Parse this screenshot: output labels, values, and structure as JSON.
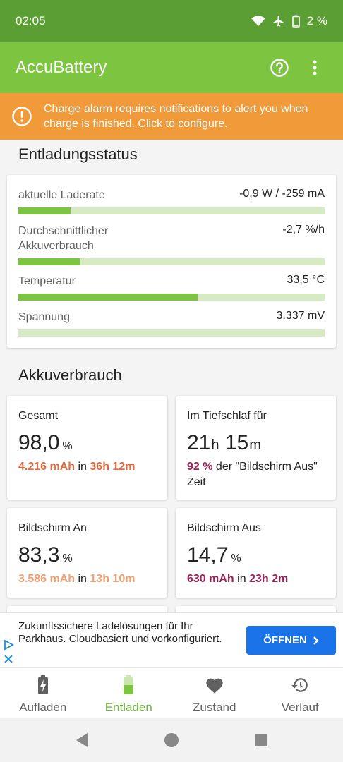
{
  "status_bar": {
    "time": "02:05",
    "battery_percent": "2 %"
  },
  "app_bar": {
    "title": "AccuBattery"
  },
  "alert": {
    "text": "Charge alarm requires notifications to alert you when charge is finished. Click to configure."
  },
  "discharge_status": {
    "title": "Entladungsstatus",
    "rows": [
      {
        "label": "aktuelle Laderate",
        "value": "-0,9 W / -259 mA",
        "fill": 0.17
      },
      {
        "label": "Durchschnittlicher Akkuverbrauch",
        "value": "-2,7 %/h",
        "fill": 0.2
      },
      {
        "label": "Temperatur",
        "value": "33,5 °C",
        "fill": 0.585
      },
      {
        "label": "Spannung",
        "value": "3.337 mV",
        "fill": 0.0
      }
    ]
  },
  "battery_usage": {
    "title": "Akkuverbrauch",
    "total": {
      "label": "Gesamt",
      "value": "98,0",
      "unit": "%",
      "mah": "4.216 mAh",
      "in": "in",
      "time": "36h 12m"
    },
    "deep_sleep": {
      "label": "Im Tiefschlaf für",
      "hours": "21",
      "h_unit": "h",
      "minutes": "15",
      "m_unit": "m",
      "percent": "92 %",
      "desc": "der \"Bildschirm Aus\" Zeit"
    },
    "screen_on": {
      "label": "Bildschirm An",
      "value": "83,3",
      "unit": "%",
      "mah": "3.586 mAh",
      "in": "in",
      "time": "13h 10m"
    },
    "screen_off": {
      "label": "Bildschirm Aus",
      "value": "14,7",
      "unit": "%",
      "mah": "630 mAh",
      "in": "in",
      "time": "23h 2m"
    }
  },
  "ad": {
    "text": "Zukunftssichere Ladelösungen für Ihr Parkhaus. Cloudbasiert und vorkonfiguriert.",
    "button": "ÖFFNEN"
  },
  "bottom_nav": [
    {
      "label": "Aufladen",
      "icon": "battery-charging-icon"
    },
    {
      "label": "Entladen",
      "icon": "battery-discharging-icon"
    },
    {
      "label": "Zustand",
      "icon": "heart-icon"
    },
    {
      "label": "Verlauf",
      "icon": "history-icon"
    }
  ],
  "colors": {
    "primary": "#7dc440",
    "primary_dark": "#5a9e34",
    "alert": "#f19a3a",
    "accent_orange": "#e5683d",
    "accent_peach": "#f0a070",
    "accent_purple": "#9a2358"
  }
}
